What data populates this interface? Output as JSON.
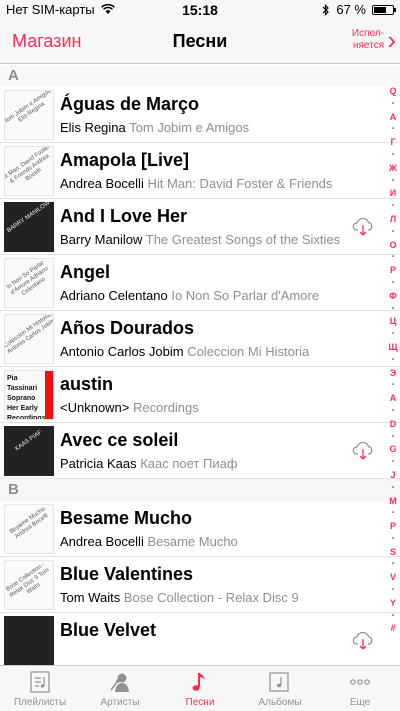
{
  "status_bar": {
    "carrier": "Нет SIM-карты",
    "time": "15:18",
    "battery": "67 %",
    "battery_level": 0.67
  },
  "nav": {
    "back_label": "Магазин",
    "title": "Песни",
    "now_playing_label": "Испол-\nняется"
  },
  "sections": [
    {
      "letter": "A",
      "songs": [
        {
          "title": "Águas de Março",
          "artist": "Elis Regina",
          "album": "Tom Jobim e Amigos",
          "art_text": "Tom Jobim e Amigos Elis Regina",
          "cloud": false
        },
        {
          "title": "Amapola [Live]",
          "artist": "Andrea Bocelli",
          "album": "Hit Man: David Foster & Friends",
          "art_text": "Hit Man: David Foster & Friends Andrea Bocelli",
          "cloud": false
        },
        {
          "title": "And I Love Her",
          "artist": "Barry Manilow",
          "album": "The Greatest Songs of the Sixties",
          "art_text": "BARRY MANILOW",
          "cloud": true
        },
        {
          "title": "Angel",
          "artist": "Adriano Celentano",
          "album": "Io Non So Parlar d'Amore",
          "art_text": "Io Non So Parlar d'Amore Adriano Celentano",
          "cloud": false
        },
        {
          "title": "Años Dourados",
          "artist": "Antonio Carlos Jobim",
          "album": "Coleccion Mi Historia",
          "art_text": "Coleccion Mi Historia Antonio Carlos Jobim",
          "cloud": false
        },
        {
          "title": "austin",
          "artist": "<Unknown>",
          "album": "Recordings",
          "art_text": "Pia Tassinari Soprano Her Early Recordings",
          "cloud": false
        },
        {
          "title": "Avec ce soleil",
          "artist": "Patricia Kaas",
          "album": "Каас поет Пиаф",
          "art_text": "KAAS PIAF",
          "cloud": true
        }
      ]
    },
    {
      "letter": "B",
      "songs": [
        {
          "title": "Besame Mucho",
          "artist": "Andrea Bocelli",
          "album": "Besame Mucho",
          "art_text": "Besame Mucho Andrea Bocelli",
          "cloud": false
        },
        {
          "title": "Blue Valentines",
          "artist": "Tom Waits",
          "album": "Bose Collection - Relax Disc 9",
          "art_text": "Bose Collection - Relax Disc 9 Tom Waits",
          "cloud": false
        },
        {
          "title": "Blue Velvet",
          "artist": "",
          "album": "",
          "art_text": "",
          "cloud": true
        }
      ]
    }
  ],
  "index_letters": [
    "Q",
    "А",
    "Г",
    "Ж",
    "И",
    "Л",
    "О",
    "Р",
    "Ф",
    "Ц",
    "Щ",
    "Э",
    "A",
    "D",
    "G",
    "J",
    "M",
    "P",
    "S",
    "V",
    "Y",
    "#"
  ],
  "tabs": [
    {
      "label": "Плейлисты",
      "icon": "playlist-icon",
      "active": false
    },
    {
      "label": "Артисты",
      "icon": "artist-icon",
      "active": false
    },
    {
      "label": "Песни",
      "icon": "music-note-icon",
      "active": true
    },
    {
      "label": "Альбомы",
      "icon": "album-icon",
      "active": false
    },
    {
      "label": "Еще",
      "icon": "more-icon",
      "active": false
    }
  ],
  "colors": {
    "accent": "#ff2d55",
    "secondary_text": "#8e8e93"
  }
}
